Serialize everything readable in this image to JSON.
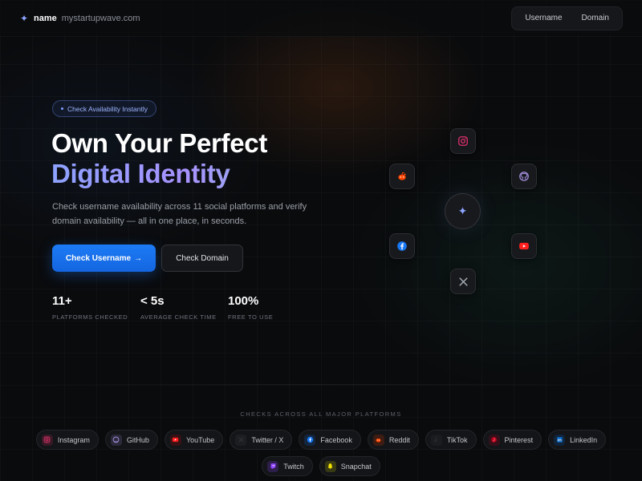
{
  "brand": {
    "name": "name",
    "domain": "mystartupwave.com",
    "icon": "sparkle-icon"
  },
  "nav": {
    "items": [
      "Username",
      "Domain"
    ]
  },
  "hero": {
    "pill": "Check Availability Instantly",
    "headline_line1": "Own Your Perfect",
    "headline_line2": "Digital Identity",
    "description": "Check username availability across 11 social platforms and verify domain availability — all in one place, in seconds.",
    "primary_button": "Check Username",
    "primary_arrow": "→",
    "secondary_button": "Check Domain"
  },
  "stats": [
    {
      "value": "11+",
      "label": "PLATFORMS CHECKED"
    },
    {
      "value": "< 5s",
      "label": "AVERAGE CHECK TIME"
    },
    {
      "value": "100%",
      "label": "FREE TO USE"
    }
  ],
  "orbit": {
    "center_icon": "sparkle-icon",
    "nodes": [
      "instagram-icon",
      "github-icon",
      "youtube-icon",
      "x-icon",
      "facebook-icon",
      "reddit-icon"
    ]
  },
  "platforms": {
    "title": "CHECKS ACROSS ALL MAJOR PLATFORMS",
    "items": [
      {
        "label": "Instagram",
        "icon": "instagram-icon",
        "color": "#e1306c"
      },
      {
        "label": "GitHub",
        "icon": "github-icon",
        "color": "#a08bd8"
      },
      {
        "label": "YouTube",
        "icon": "youtube-icon",
        "color": "#ff0000"
      },
      {
        "label": "Twitter / X",
        "icon": "x-icon",
        "color": "#3a3d42"
      },
      {
        "label": "Facebook",
        "icon": "facebook-icon",
        "color": "#1877f2"
      },
      {
        "label": "Reddit",
        "icon": "reddit-icon",
        "color": "#ff4500"
      },
      {
        "label": "TikTok",
        "icon": "tiktok-icon",
        "color": "#1a1c1f"
      },
      {
        "label": "Pinterest",
        "icon": "pinterest-icon",
        "color": "#e60023"
      },
      {
        "label": "LinkedIn",
        "icon": "linkedin-icon",
        "color": "#0a66c2"
      },
      {
        "label": "Twitch",
        "icon": "twitch-icon",
        "color": "#9146ff"
      },
      {
        "label": "Snapchat",
        "icon": "snapchat-icon",
        "color": "#fffc00"
      }
    ]
  }
}
